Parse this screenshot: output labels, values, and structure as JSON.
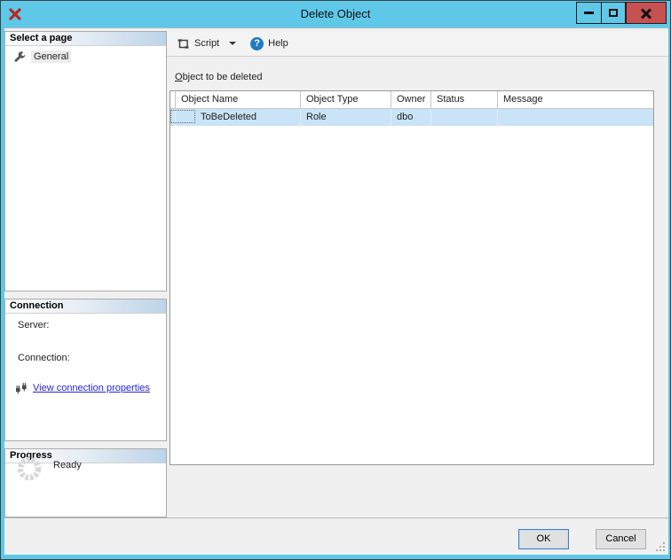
{
  "window": {
    "title": "Delete Object"
  },
  "sidebar": {
    "pages": {
      "header": "Select a page",
      "items": [
        {
          "label": "General"
        }
      ]
    },
    "connection": {
      "header": "Connection",
      "server_label": "Server:",
      "connection_label": "Connection:",
      "link_label": "View connection properties"
    },
    "progress": {
      "header": "Progress",
      "status": "Ready"
    }
  },
  "toolbar": {
    "script_label": "Script",
    "help_label": "Help",
    "help_glyph": "?"
  },
  "main": {
    "grid_label": {
      "mnemonic": "O",
      "rest": "bject to be deleted"
    },
    "table": {
      "columns": [
        "Object Name",
        "Object Type",
        "Owner",
        "Status",
        "Message"
      ],
      "rows": [
        {
          "object_name": "ToBeDeleted",
          "object_type": "Role",
          "owner": "dbo",
          "status": "",
          "message": ""
        }
      ]
    }
  },
  "footer": {
    "ok_label": "OK",
    "cancel_label": "Cancel"
  },
  "icons": {
    "app": "delete-x-icon",
    "page": "wrench-icon",
    "connection": "plugs-icon",
    "progress": "spinner-icon",
    "script": "script-icon",
    "help": "help-icon"
  },
  "colors": {
    "titlebar": "#5FC8E8",
    "close_button": "#C75050",
    "row_highlight": "#C9E4F7",
    "link": "#2525CD",
    "default_button_border": "#3D7EBD",
    "section_header_gradient_end": "#BCD4E8"
  }
}
